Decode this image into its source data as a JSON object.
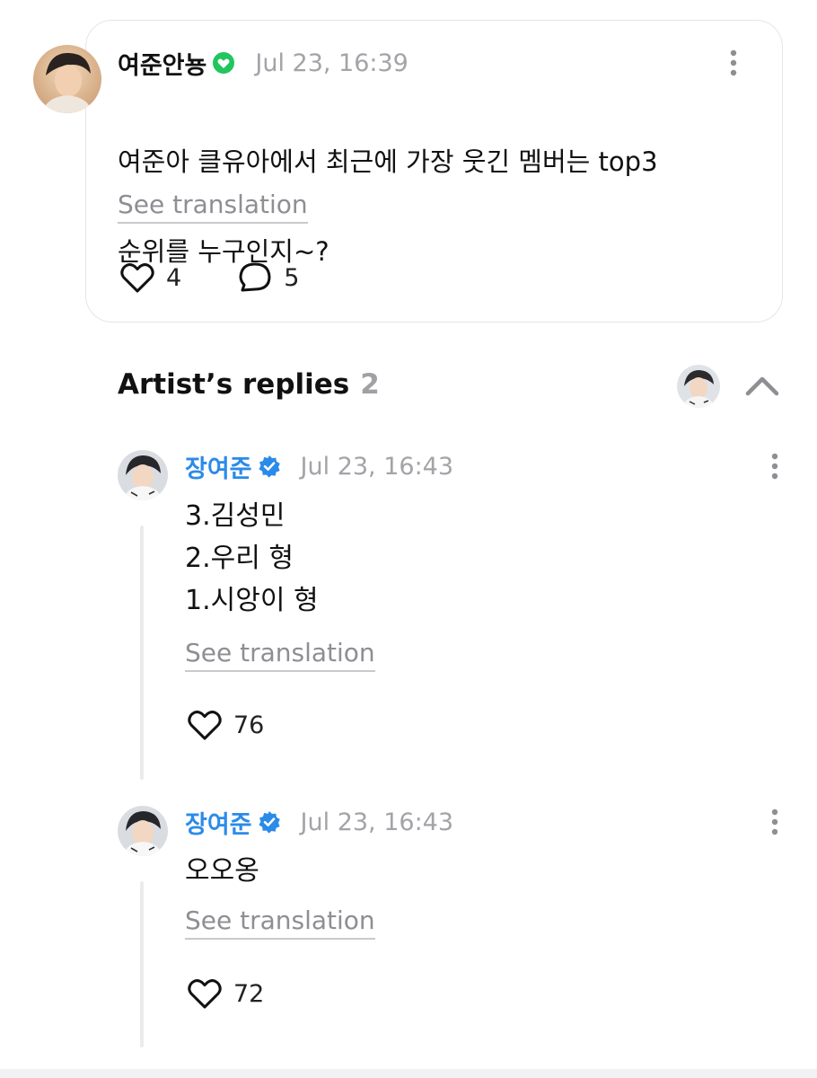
{
  "post": {
    "author": "여준안뇽",
    "timestamp": "Jul 23, 16:39",
    "text_lines": [
      "여준아 클유아에서 최근에 가장 웃긴 멤버는 top3",
      "순위를 누구인지~?"
    ],
    "see_translation": "See translation",
    "like_count": "4",
    "comment_count": "5"
  },
  "artist_replies": {
    "title": "Artist’s replies",
    "count": "2"
  },
  "replies": [
    {
      "author": "장여준",
      "timestamp": "Jul 23, 16:43",
      "lines": [
        "3.김성민",
        "2.우리 형",
        "1.시앙이 형"
      ],
      "see_translation": "See translation",
      "like_count": "76"
    },
    {
      "author": "장여준",
      "timestamp": "Jul 23, 16:43",
      "lines": [
        "오오옹"
      ],
      "see_translation": "See translation",
      "like_count": "72"
    }
  ],
  "colors": {
    "artist_name": "#2b8be9",
    "fan_badge": "#22c55e",
    "verified_badge": "#2b8be9",
    "muted_text": "#a3a3a8"
  },
  "icons": {
    "like": "heart-icon",
    "comment": "comment-bubble-icon",
    "more": "more-vertical-icon",
    "collapse": "chevron-up-icon",
    "fan_badge": "heart-badge-icon",
    "verified": "verified-check-icon"
  }
}
